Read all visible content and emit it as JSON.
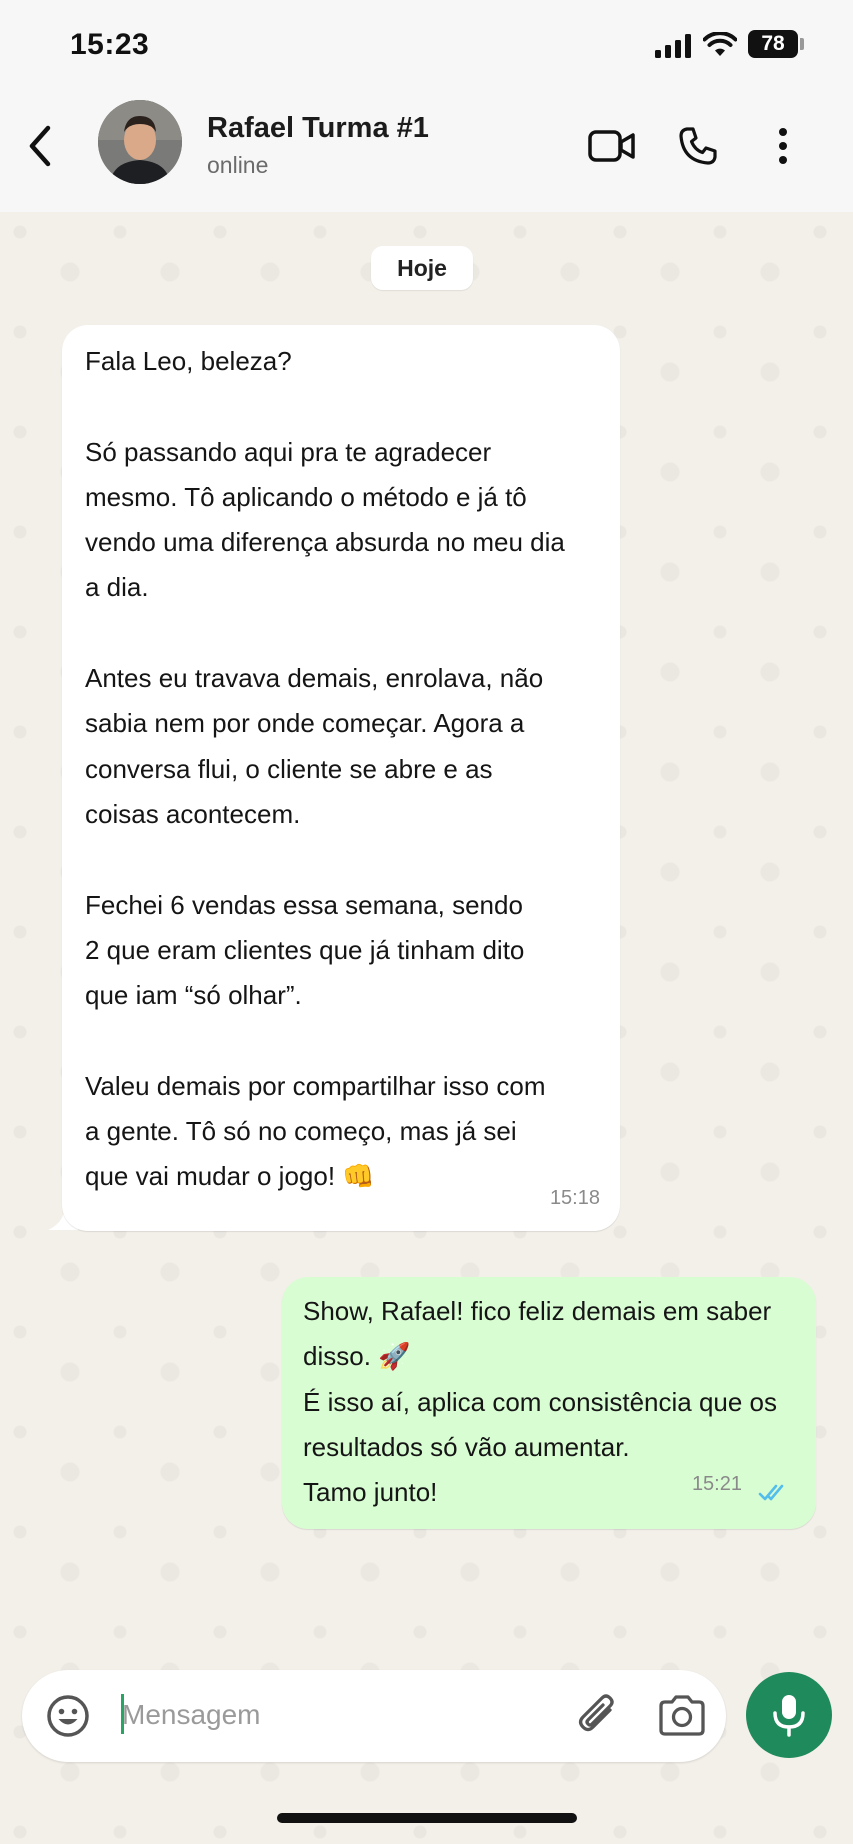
{
  "status_bar": {
    "time": "15:23",
    "battery": "78"
  },
  "header": {
    "contact_name": "Rafael Turma #1",
    "contact_status": "online",
    "icons": [
      "back-arrow-icon",
      "video-call-icon",
      "phone-call-icon",
      "more-vertical-icon"
    ]
  },
  "chat": {
    "date_label": "Hoje",
    "messages": [
      {
        "direction": "incoming",
        "text": "Fala Leo, beleza?\n\nSó passando aqui pra te agradecer\nmesmo. Tô aplicando o método e já tô\nvendo uma diferença absurda no meu dia\na dia.\n\nAntes eu travava demais, enrolava, não\nsabia nem por onde começar. Agora a\nconversa flui, o cliente se abre e as\ncoisas acontecem.\n\nFechei 6 vendas essa semana, sendo\n2 que eram clientes que já tinham dito\nque iam “só olhar”.\n\nValeu demais por compartilhar isso com\na gente. Tô só no começo, mas já sei\nque vai mudar o jogo! 👊",
        "time": "15:18"
      },
      {
        "direction": "outgoing",
        "text": "Show, Rafael! fico feliz demais em saber\ndisso. 🚀\nÉ isso aí, aplica com consistência que os\nresultados só vão aumentar.\nTamo junto!",
        "time": "15:21",
        "status": "read"
      }
    ]
  },
  "composer": {
    "placeholder": "Mensagem",
    "value": ""
  },
  "colors": {
    "incoming_bubble": "#ffffff",
    "outgoing_bubble": "#d9fdd3",
    "mic_button": "#1f8a5b",
    "read_ticks": "#53bdeb"
  }
}
